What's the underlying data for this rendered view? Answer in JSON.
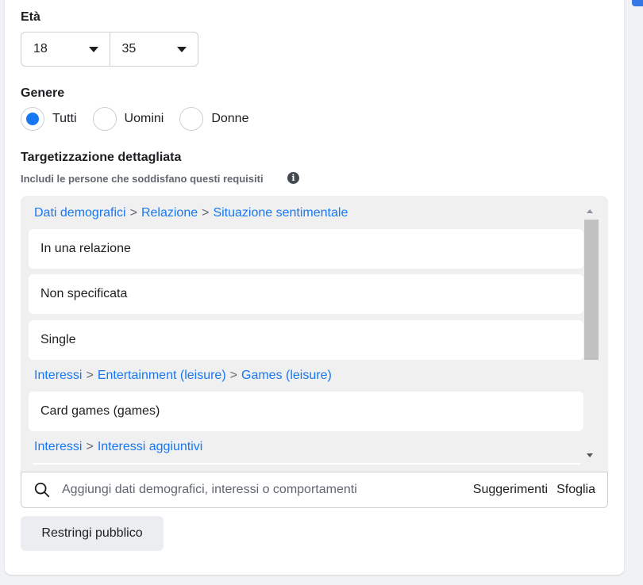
{
  "colors": {
    "accent": "#1877f2",
    "panel_bg": "#f0f0f0",
    "text": "#1c1e21",
    "muted": "#606770"
  },
  "age": {
    "label": "Età",
    "min": "18",
    "max": "35"
  },
  "gender": {
    "label": "Genere",
    "options": [
      {
        "label": "Tutti",
        "selected": true
      },
      {
        "label": "Uomini",
        "selected": false
      },
      {
        "label": "Donne",
        "selected": false
      }
    ]
  },
  "targeting": {
    "title": "Targetizzazione dettagliata",
    "subtitle": "Includi le persone che soddisfano questi requisiti",
    "info_icon": "info-icon",
    "groups": [
      {
        "path": [
          "Dati demografici",
          "Relazione",
          "Situazione sentimentale"
        ],
        "items": [
          "In una relazione",
          "Non specificata",
          "Single"
        ]
      },
      {
        "path": [
          "Interessi",
          "Entertainment (leisure)",
          "Games (leisure)"
        ],
        "items": [
          "Card games (games)"
        ]
      },
      {
        "path": [
          "Interessi",
          "Interessi aggiuntivi"
        ],
        "items": []
      }
    ],
    "separator": ">",
    "search_placeholder": "Aggiungi dati demografici, interessi o comportamenti",
    "suggestions_label": "Suggerimenti",
    "browse_label": "Sfoglia"
  },
  "narrow_button": "Restringi pubblico"
}
